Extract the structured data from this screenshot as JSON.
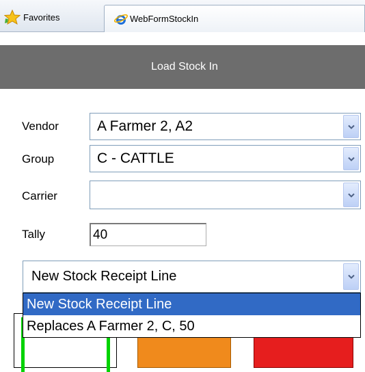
{
  "browser": {
    "favorites_label": "Favorites",
    "tab_title": "WebFormStockIn"
  },
  "header": {
    "title": "Load Stock In"
  },
  "form": {
    "vendor": {
      "label": "Vendor",
      "value": "A Farmer 2, A2"
    },
    "group": {
      "label": "Group",
      "value": "C - CATTLE"
    },
    "carrier": {
      "label": "Carrier",
      "value": ""
    },
    "tally": {
      "label": "Tally",
      "value": "40"
    },
    "receipt_line": {
      "value": "New Stock Receipt Line",
      "options": [
        "New Stock Receipt Line",
        "Replaces A Farmer 2, C, 50"
      ],
      "highlighted_index": 0
    }
  },
  "colors": {
    "header_bg": "#6d6d6d",
    "highlight": "#316ac5",
    "button_green": "#00d300",
    "button_orange": "#f08a1c",
    "button_red": "#e61e1e"
  },
  "icons": {
    "favorites": "star-icon",
    "tab": "internet-explorer-icon",
    "dropdown": "chevron-down-icon"
  }
}
